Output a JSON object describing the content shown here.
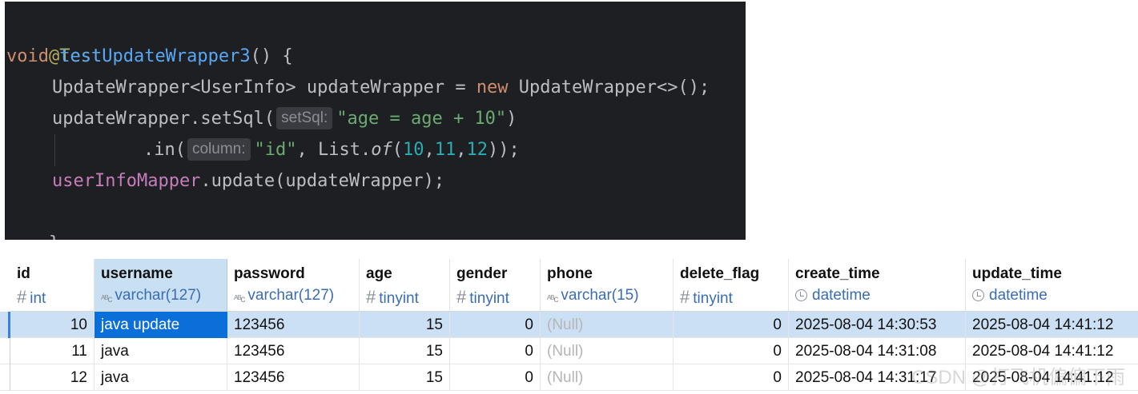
{
  "code": {
    "line1": "@Test",
    "line2": {
      "kw": "void",
      "fn": "testUpdateWrapper3",
      "rest": "() {"
    },
    "line3": {
      "type": "UpdateWrapper<UserInfo> updateWrapper = ",
      "kw": "new",
      "rest": " UpdateWrapper<>();"
    },
    "line4": {
      "call": "updateWrapper.setSql(",
      "hint": "setSql:",
      "str": "\"age = age + 10\"",
      "close": ")"
    },
    "line5": {
      "call": ".in(",
      "hint": "column:",
      "str": "\"id\"",
      "mid": ", List.",
      "method": "of",
      "open": "(",
      "n1": "10",
      "n2": "11",
      "n3": "12",
      "close": "));"
    },
    "line6": {
      "field": "userInfoMapper",
      "rest": ".update(updateWrapper);"
    },
    "line7": "}"
  },
  "table": {
    "columns": [
      {
        "name": "id",
        "type": "int"
      },
      {
        "name": "username",
        "type": "varchar(127)"
      },
      {
        "name": "password",
        "type": "varchar(127)"
      },
      {
        "name": "age",
        "type": "tinyint"
      },
      {
        "name": "gender",
        "type": "tinyint"
      },
      {
        "name": "phone",
        "type": "varchar(15)"
      },
      {
        "name": "delete_flag",
        "type": "tinyint"
      },
      {
        "name": "create_time",
        "type": "datetime"
      },
      {
        "name": "update_time",
        "type": "datetime"
      }
    ],
    "rows": [
      [
        "10",
        "java update",
        "123456",
        "15",
        "0",
        "(Null)",
        "0",
        "2025-08-04 14:30:53",
        "2025-08-04 14:41:12"
      ],
      [
        "11",
        "java",
        "123456",
        "15",
        "0",
        "(Null)",
        "0",
        "2025-08-04 14:31:08",
        "2025-08-04 14:41:12"
      ],
      [
        "12",
        "java",
        "123456",
        "15",
        "0",
        "(Null)",
        "0",
        "2025-08-04 14:31:17",
        "2025-08-04 14:41:12"
      ]
    ]
  },
  "watermark": "CSDN @打飞机偏偏下雨"
}
